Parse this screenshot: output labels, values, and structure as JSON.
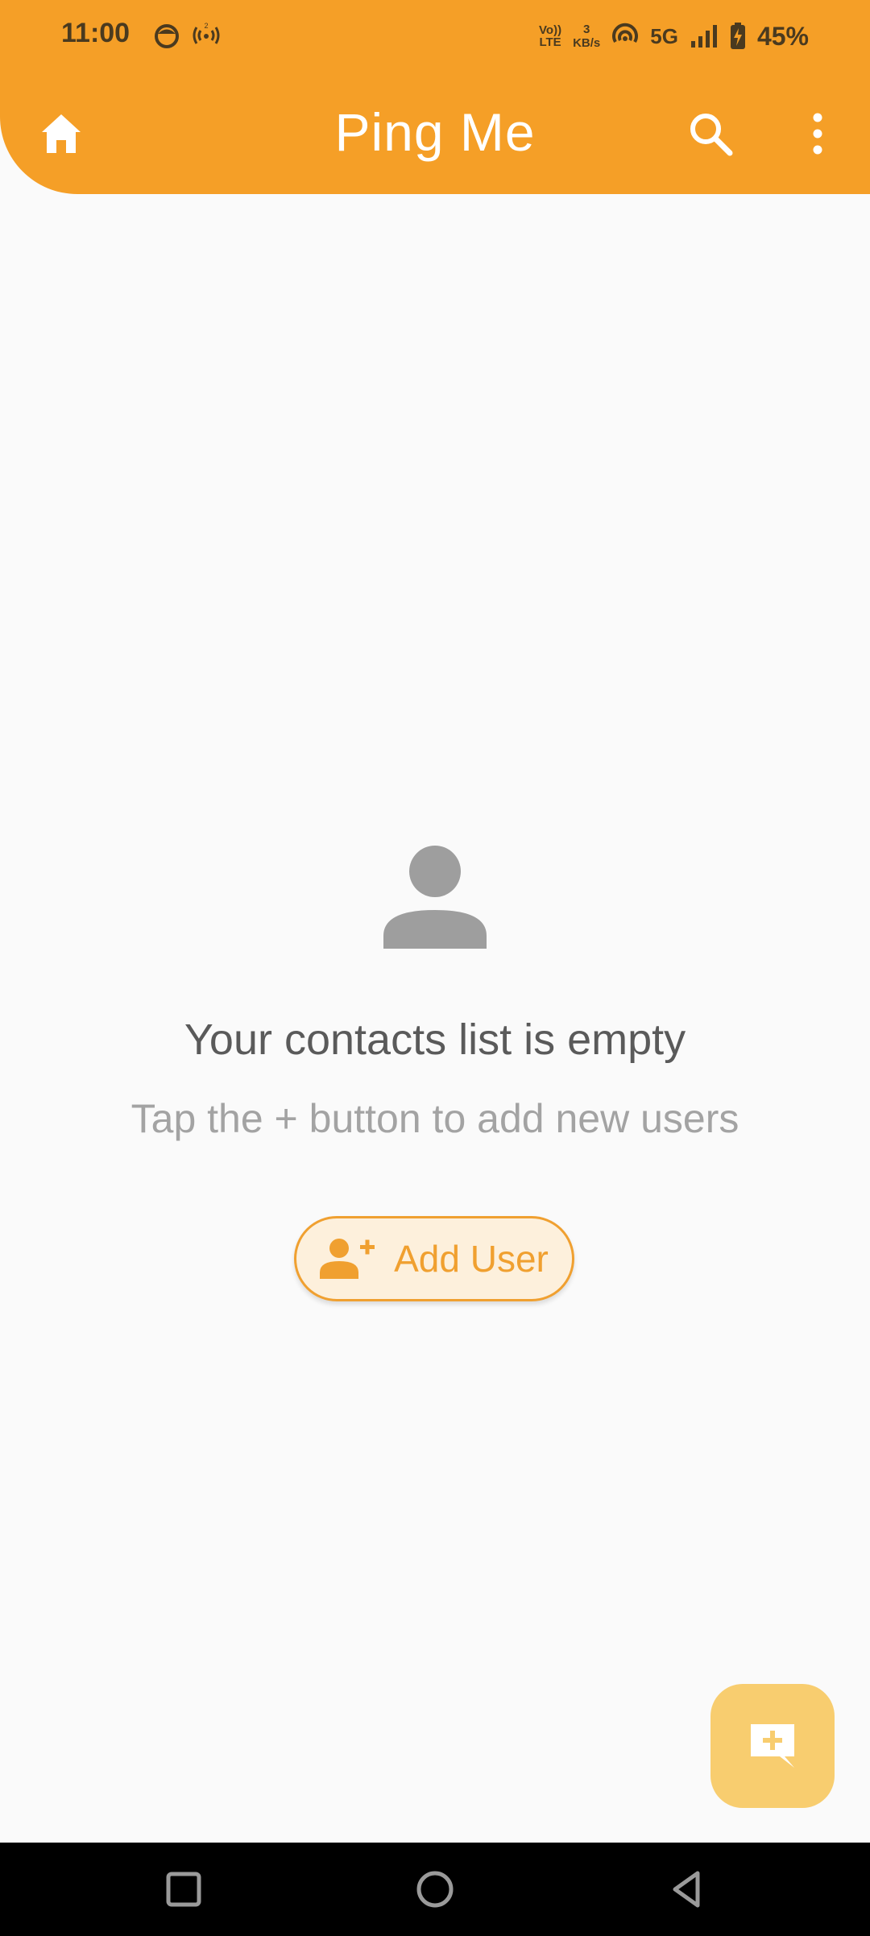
{
  "status_bar": {
    "time": "11:00",
    "volte_top": "Vo))",
    "volte_bottom": "LTE",
    "net_speed_value": "3",
    "net_speed_unit": "KB/s",
    "network_type": "5G",
    "battery_percent": "45%",
    "icons": [
      "notification-face-icon",
      "hotspot-icon",
      "wifi-calling-icon",
      "signal-icon",
      "battery-charging-icon"
    ]
  },
  "app_bar": {
    "title": "Ping Me",
    "icons": [
      "home-icon",
      "search-icon",
      "more-vert-icon"
    ]
  },
  "empty_state": {
    "title": "Your contacts list is empty",
    "subtitle": "Tap the + button to add new users",
    "icon": "person-icon"
  },
  "add_user_button": {
    "label": "Add User",
    "icon": "person-add-icon"
  },
  "fab": {
    "icon": "add-chat-icon"
  },
  "nav_bar": {
    "icons": [
      "recent-apps-icon",
      "home-circle-icon",
      "back-icon"
    ]
  },
  "colors": {
    "primary": "#f59f27",
    "background": "#fafafa",
    "fab": "#f8cd6f",
    "button_bg": "#fdf0dc",
    "accent_text": "#f0a030",
    "title_text": "#5a5a5a",
    "subtitle_text": "#a3a3a3"
  }
}
